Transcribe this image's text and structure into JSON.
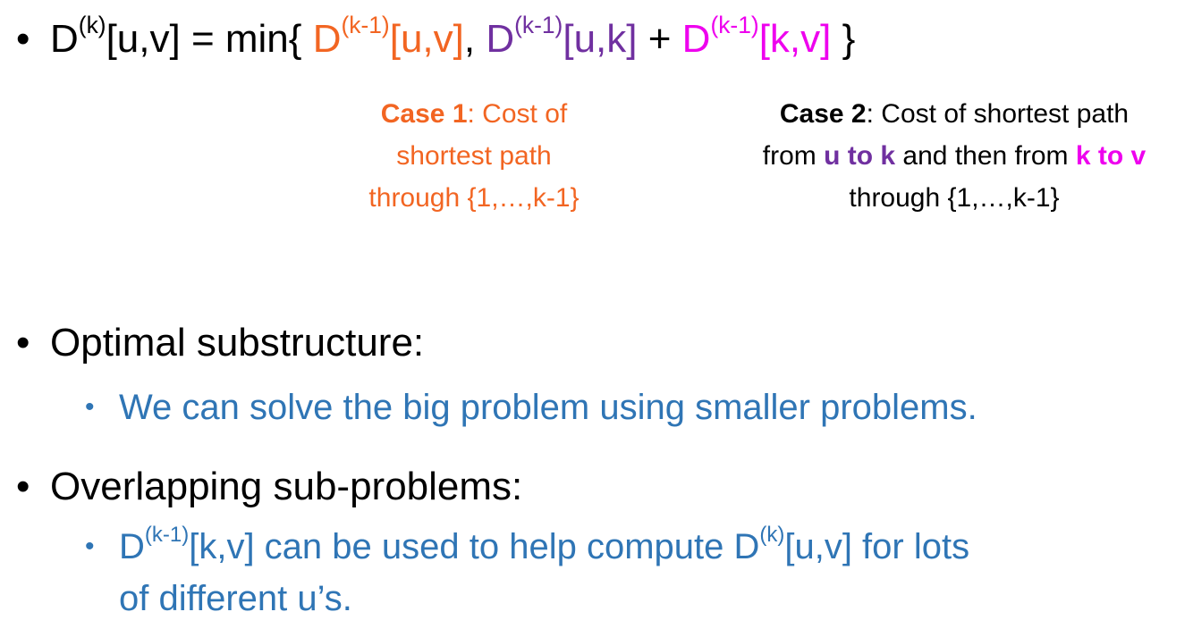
{
  "recurrence": {
    "bullet": "•",
    "lhs_D": "D",
    "lhs_sup": "(k)",
    "lhs_args": "[u,v]",
    "eq_min": " = min{ ",
    "t1_D": "D",
    "t1_sup": "(k-1)",
    "t1_args": "[u,v]",
    "comma": ", ",
    "t2_D": "D",
    "t2_sup": "(k-1)",
    "t2_args": "[u,k]",
    "plus": " + ",
    "t3_D": "D",
    "t3_sup": "(k-1)",
    "t3_args": "[k,v]",
    "close": " }"
  },
  "case1": {
    "bold": "Case 1",
    "line1_rest": ": Cost of",
    "line2": "shortest path",
    "line3": "through {1,…,k-1}"
  },
  "case2": {
    "bold": "Case 2",
    "line1_rest": ": Cost of shortest path",
    "line2_a": "from ",
    "line2_u_to_k": "u to k",
    "line2_b": " and then from ",
    "line2_k_to_v": "k to v",
    "line3": "through {1,…,k-1}"
  },
  "optimal": {
    "bullet": "•",
    "title": "Optimal substructure:",
    "sub_bullet": "•",
    "sub_text": "We can solve the big problem using smaller problems."
  },
  "overlapping": {
    "bullet": "•",
    "title": "Overlapping sub-problems:",
    "sub_bullet": "•",
    "sub_D1": "D",
    "sub_sup1": "(k-1)",
    "sub_mid": "[k,v] can be used to help compute D",
    "sub_sup2": "(k)",
    "sub_end": "[u,v] for lots",
    "sub_line2": "of different u’s."
  },
  "colors": {
    "orange": "#f26522",
    "purple": "#7030a0",
    "magenta": "#ee00ee",
    "blue": "#2f75b5",
    "text": "#000000"
  }
}
